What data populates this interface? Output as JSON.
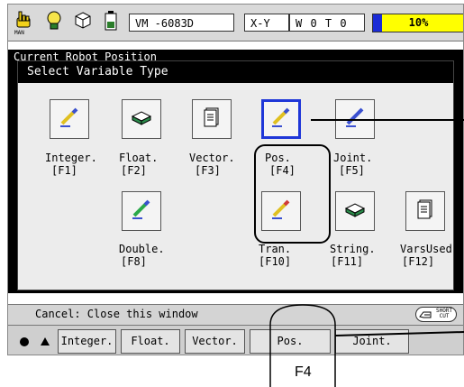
{
  "topbar": {
    "mode_label": "MAN",
    "vm_field": "VM  -6083D",
    "coord_label": "X-Y",
    "coord_value": "W 0 T 0",
    "progress_text": "10%",
    "progress_fraction": 0.1,
    "icons": [
      "hand-pointer-icon",
      "lightbulb-icon",
      "cube-icon",
      "battery-icon"
    ]
  },
  "background_window": {
    "title": "Current Robot Position"
  },
  "dialog": {
    "title": "Select Variable Type",
    "selected": "Pos.",
    "items": [
      {
        "name": "Integer.",
        "key": "[F1]",
        "icon": "pencil-icon"
      },
      {
        "name": "Float.",
        "key": "[F2]",
        "icon": "disk-icon"
      },
      {
        "name": "Vector.",
        "key": "[F3]",
        "icon": "document-icon"
      },
      {
        "name": "Pos.",
        "key": "[F4]",
        "icon": "pencil-icon"
      },
      {
        "name": "Joint.",
        "key": "[F5]",
        "icon": "pencil-icon"
      },
      {
        "name": "Double.",
        "key": "[F8]",
        "icon": "pencil-icon"
      },
      {
        "name": "Tran.",
        "key": "[F10]",
        "icon": "pencil-icon"
      },
      {
        "name": "String.",
        "key": "[F11]",
        "icon": "disk-icon"
      },
      {
        "name": "VarsUsed",
        "key": "[F12]",
        "icon": "document-icon"
      }
    ]
  },
  "status": {
    "cancel_hint": "Cancel: Close this window",
    "shortcut_label": "SHORT CUT"
  },
  "function_keys": [
    "Integer.",
    "Float.",
    "Vector.",
    "Pos.",
    "Joint."
  ],
  "annotation": {
    "label": "F4"
  },
  "colors": {
    "selection_blue": "#1f37d8",
    "progress_yellow": "#ffff00",
    "progress_fill": "#1a2bd6"
  }
}
